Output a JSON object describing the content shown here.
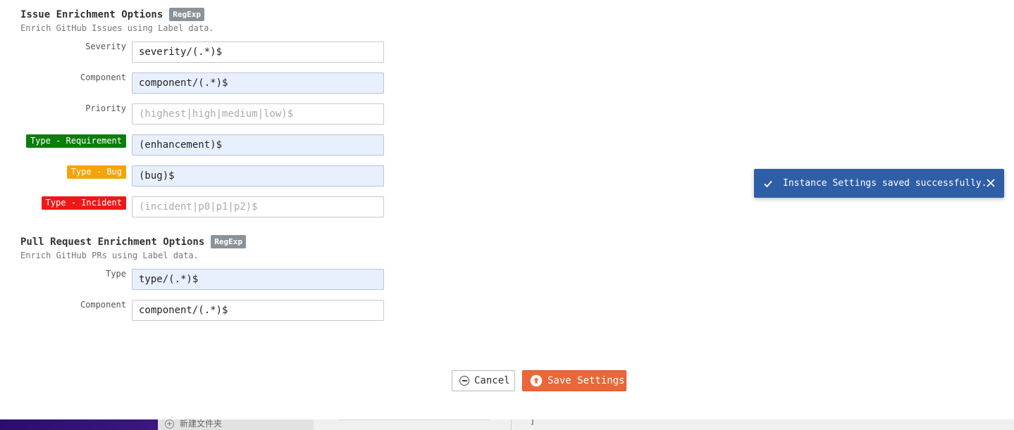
{
  "issue_section": {
    "title": "Issue Enrichment Options",
    "badge": "RegExp",
    "description": "Enrich GitHub Issues using Label data."
  },
  "issue_fields": {
    "severity": {
      "label": "Severity",
      "value": "severity/(.*)$",
      "placeholder": ""
    },
    "component": {
      "label": "Component",
      "value": "component/(.*)$",
      "placeholder": ""
    },
    "priority": {
      "label": "Priority",
      "value": "",
      "placeholder": "(highest|high|medium|low)$"
    },
    "type_requirement": {
      "label": "Type - Requirement",
      "color": "#0b7d0b",
      "value": "(enhancement)$",
      "placeholder": ""
    },
    "type_bug": {
      "label": "Type - Bug",
      "color": "#f5a30a",
      "value": "(bug)$",
      "placeholder": ""
    },
    "type_incident": {
      "label": "Type - Incident",
      "color": "#ef1818",
      "value": "",
      "placeholder": "(incident|p0|p1|p2)$"
    }
  },
  "pr_section": {
    "title": "Pull Request Enrichment Options",
    "badge": "RegExp",
    "description": "Enrich GitHub PRs using Label data."
  },
  "pr_fields": {
    "type": {
      "label": "Type",
      "value": "type/(.*)$",
      "placeholder": ""
    },
    "component": {
      "label": "Component",
      "value": "component/(.*)$",
      "placeholder": ""
    }
  },
  "actions": {
    "cancel_label": "Cancel",
    "save_label": "Save Settings",
    "save_color": "#ed6639"
  },
  "toast": {
    "message": "Instance Settings saved successfully.",
    "icon": "check-icon",
    "color": "#2f5ea8"
  },
  "taskbar": {
    "new_folder_label": "新建文件夹",
    "bracket_text": "]"
  }
}
